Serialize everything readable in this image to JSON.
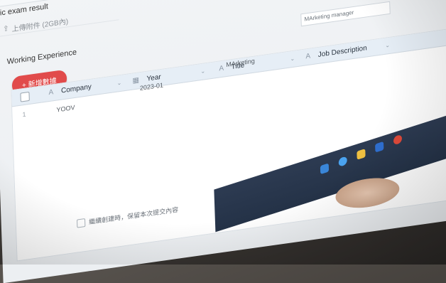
{
  "form": {
    "exam_label": "blic exam result",
    "upload_hint": "上傳附件 (2GB內)",
    "upload_icon": "upload-icon"
  },
  "working_experience": {
    "label": "Working Experience",
    "add_button_label": "+ 新增數據",
    "columns": [
      {
        "name": "Company",
        "icon": "text-icon",
        "glyph": "A"
      },
      {
        "name": "Year",
        "icon": "calendar-icon",
        "glyph": "▦"
      },
      {
        "name": "Title",
        "icon": "text-icon",
        "glyph": "A"
      },
      {
        "name": "Job Description",
        "icon": "text-icon",
        "glyph": "A"
      }
    ],
    "rows": [
      {
        "index": "1",
        "company": "YOOV",
        "year": "2023-01",
        "title": "MArketing",
        "job_description": "MArketing manager"
      }
    ]
  },
  "footer": {
    "note": "繼續創建時，保留本次提交內容"
  },
  "colors": {
    "accent_red": "#e14b4b",
    "header_bg": "#e6eef6",
    "taskbar": "#243247"
  }
}
